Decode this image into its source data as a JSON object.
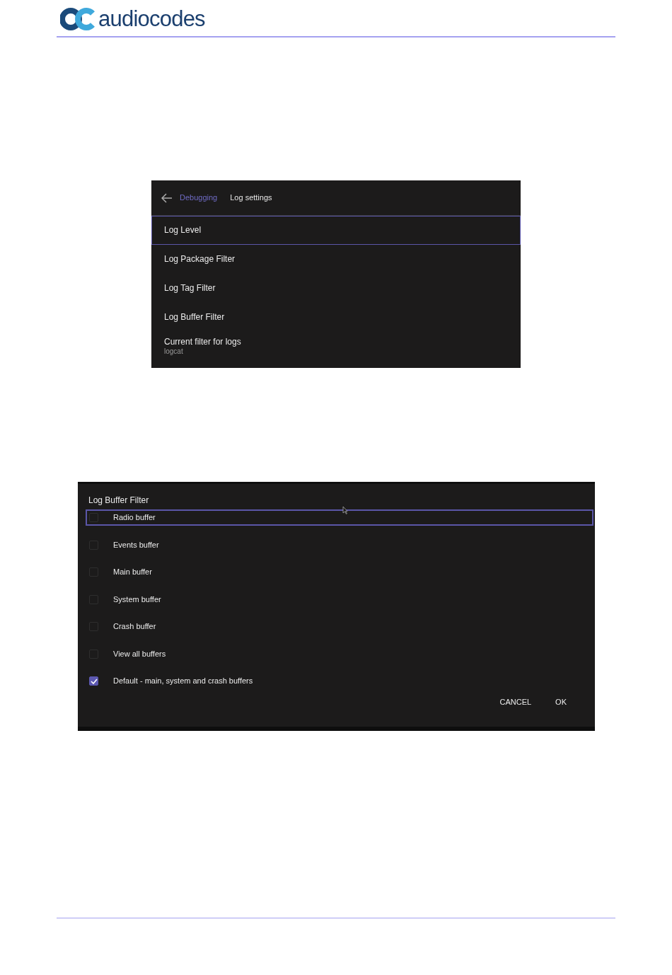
{
  "header": {
    "logo_text": "audiocodes"
  },
  "log_settings_screen": {
    "breadcrumb": {
      "parent": "Debugging",
      "current": "Log settings"
    },
    "items": [
      {
        "title": "Log Level",
        "focused": true
      },
      {
        "title": "Log Package Filter",
        "focused": false
      },
      {
        "title": "Log Tag Filter",
        "focused": false
      },
      {
        "title": "Log Buffer Filter",
        "focused": false
      },
      {
        "title": "Current filter for logs",
        "subtitle": "logcat",
        "focused": false
      }
    ]
  },
  "log_buffer_dialog": {
    "title": "Log Buffer Filter",
    "options": [
      {
        "label": "Radio buffer",
        "checked": false,
        "focused": true
      },
      {
        "label": "Events buffer",
        "checked": false,
        "focused": false
      },
      {
        "label": "Main buffer",
        "checked": false,
        "focused": false
      },
      {
        "label": "System buffer",
        "checked": false,
        "focused": false
      },
      {
        "label": "Crash buffer",
        "checked": false,
        "focused": false
      },
      {
        "label": "View all buffers",
        "checked": false,
        "focused": false
      },
      {
        "label": "Default - main, system and crash buffers",
        "checked": true,
        "focused": false
      }
    ],
    "buttons": [
      "CANCEL",
      "OK"
    ]
  }
}
